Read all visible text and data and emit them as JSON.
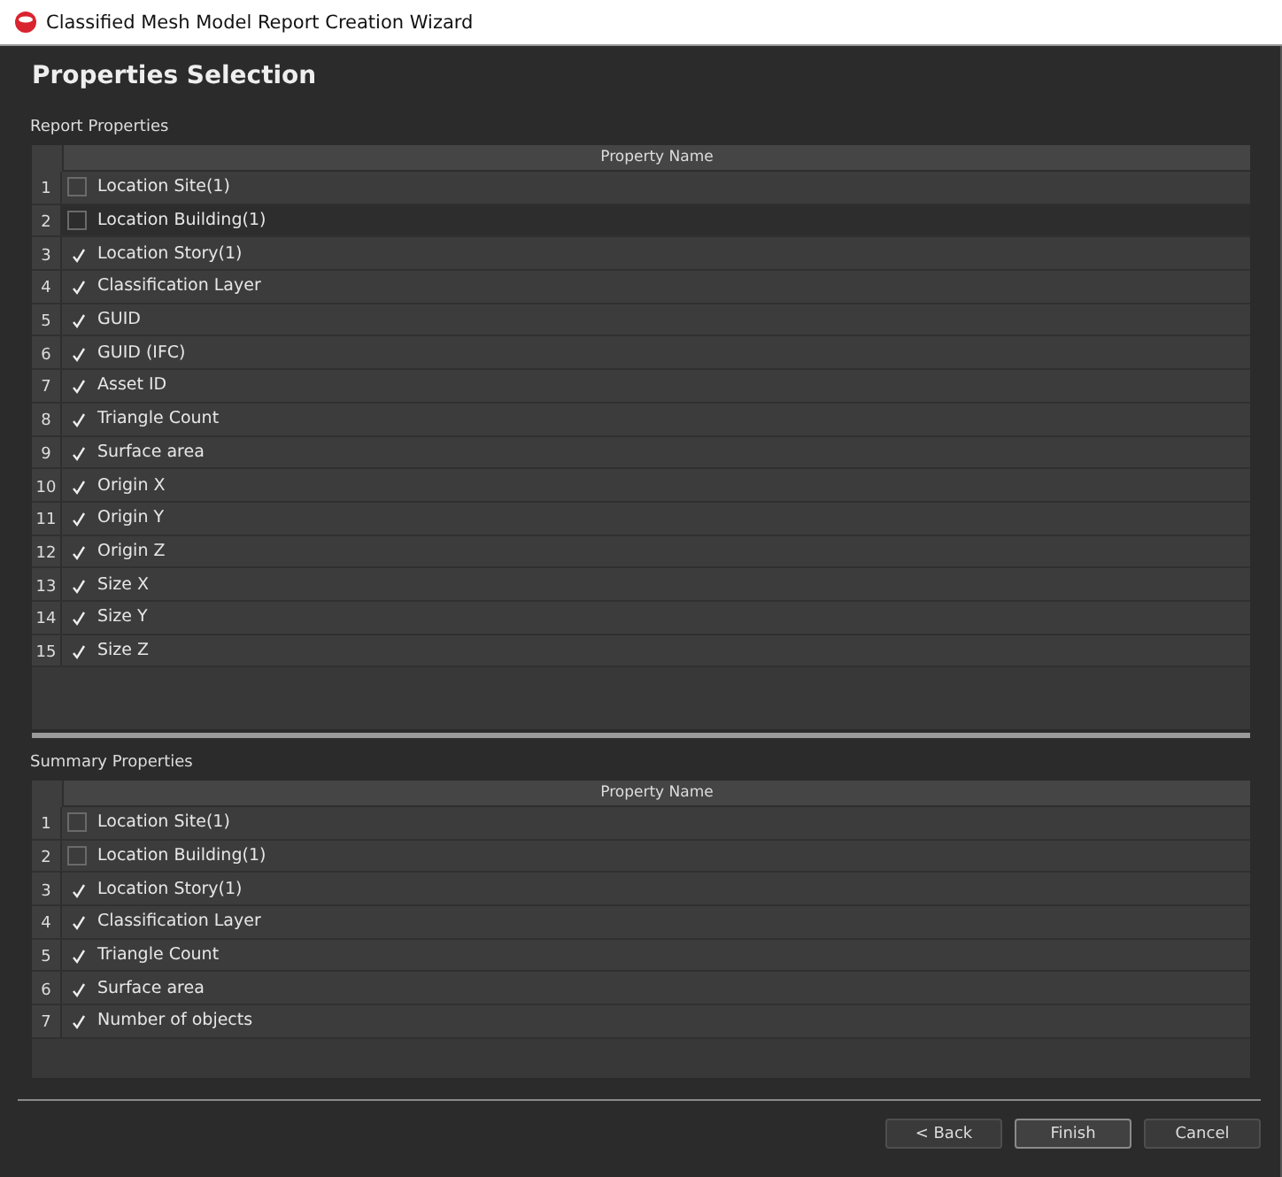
{
  "window": {
    "title": "Classified Mesh Model Report Creation Wizard"
  },
  "heading": "Properties Selection",
  "report_properties": {
    "label": "Report Properties",
    "column": "Property Name",
    "rows": [
      {
        "number": "1",
        "name": "Location Site(1)",
        "checked": false,
        "selected": false
      },
      {
        "number": "2",
        "name": "Location Building(1)",
        "checked": false,
        "selected": true
      },
      {
        "number": "3",
        "name": "Location Story(1)",
        "checked": true,
        "selected": false
      },
      {
        "number": "4",
        "name": "Classification Layer",
        "checked": true,
        "selected": false
      },
      {
        "number": "5",
        "name": "GUID",
        "checked": true,
        "selected": false
      },
      {
        "number": "6",
        "name": "GUID (IFC)",
        "checked": true,
        "selected": false
      },
      {
        "number": "7",
        "name": "Asset ID",
        "checked": true,
        "selected": false
      },
      {
        "number": "8",
        "name": "Triangle Count",
        "checked": true,
        "selected": false
      },
      {
        "number": "9",
        "name": "Surface area",
        "checked": true,
        "selected": false
      },
      {
        "number": "10",
        "name": "Origin X",
        "checked": true,
        "selected": false
      },
      {
        "number": "11",
        "name": "Origin Y",
        "checked": true,
        "selected": false
      },
      {
        "number": "12",
        "name": "Origin Z",
        "checked": true,
        "selected": false
      },
      {
        "number": "13",
        "name": "Size X",
        "checked": true,
        "selected": false
      },
      {
        "number": "14",
        "name": "Size Y",
        "checked": true,
        "selected": false
      },
      {
        "number": "15",
        "name": "Size Z",
        "checked": true,
        "selected": false
      }
    ]
  },
  "summary_properties": {
    "label": "Summary Properties",
    "column": "Property Name",
    "rows": [
      {
        "number": "1",
        "name": "Location Site(1)",
        "checked": false,
        "selected": false
      },
      {
        "number": "2",
        "name": "Location Building(1)",
        "checked": false,
        "selected": false
      },
      {
        "number": "3",
        "name": "Location Story(1)",
        "checked": true,
        "selected": false
      },
      {
        "number": "4",
        "name": "Classification Layer",
        "checked": true,
        "selected": false
      },
      {
        "number": "5",
        "name": "Triangle Count",
        "checked": true,
        "selected": false
      },
      {
        "number": "6",
        "name": "Surface area",
        "checked": true,
        "selected": false
      },
      {
        "number": "7",
        "name": "Number of objects",
        "checked": true,
        "selected": false
      }
    ]
  },
  "buttons": [
    {
      "label": "< Back",
      "default": false
    },
    {
      "label": "Finish",
      "default": true
    },
    {
      "label": "Cancel",
      "default": false
    }
  ]
}
